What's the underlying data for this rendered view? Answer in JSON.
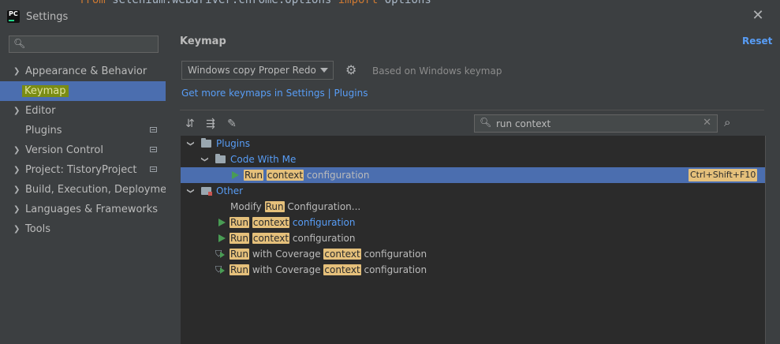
{
  "window": {
    "title": "Settings",
    "app_logo": "PC",
    "close_icon": "close-icon",
    "code_peek": {
      "kw1": "from",
      "mid": " selenium.webdriver.chrome.options ",
      "kw2": "import",
      "tail": " Options"
    }
  },
  "sidebar": {
    "search_placeholder": "",
    "items": [
      {
        "label": "Appearance & Behavior",
        "expandable": true,
        "project_icon": false
      },
      {
        "label": "Keymap",
        "expandable": false,
        "selected": true,
        "project_icon": false
      },
      {
        "label": "Editor",
        "expandable": true,
        "project_icon": false
      },
      {
        "label": "Plugins",
        "expandable": false,
        "project_icon": true
      },
      {
        "label": "Version Control",
        "expandable": true,
        "project_icon": true
      },
      {
        "label": "Project: TistoryProject",
        "expandable": true,
        "project_icon": true
      },
      {
        "label": "Build, Execution, Deployment",
        "expandable": true,
        "project_icon": false
      },
      {
        "label": "Languages & Frameworks",
        "expandable": true,
        "project_icon": false
      },
      {
        "label": "Tools",
        "expandable": true,
        "project_icon": false
      }
    ]
  },
  "content": {
    "title": "Keymap",
    "reset_label": "Reset",
    "keymap_selected": "Windows copy Proper Redo",
    "based_on": "Based on Windows keymap",
    "more_link": "Get more keymaps in Settings | Plugins",
    "filter_value": "run context",
    "tree": {
      "plugins": "Plugins",
      "code_with_me": "Code With Me",
      "row_selected": {
        "w1": "Run",
        "w2": "context",
        "rest": " configuration",
        "shortcut": "Ctrl+Shift+F10"
      },
      "other": "Other",
      "modify": {
        "pre": "Modify ",
        "w1": "Run",
        "rest": " Configuration..."
      },
      "row_a": {
        "w1": "Run",
        "w2": "context",
        "rest": " configuration"
      },
      "row_b": {
        "w1": "Run",
        "w2": "context",
        "rest": " configuration"
      },
      "row_c": {
        "w1": "Run",
        "mid": " with Coverage ",
        "w2": "context",
        "rest": " configuration"
      },
      "row_d": {
        "w1": "Run",
        "mid": " with Coverage ",
        "w2": "context",
        "rest": " configuration"
      }
    }
  }
}
